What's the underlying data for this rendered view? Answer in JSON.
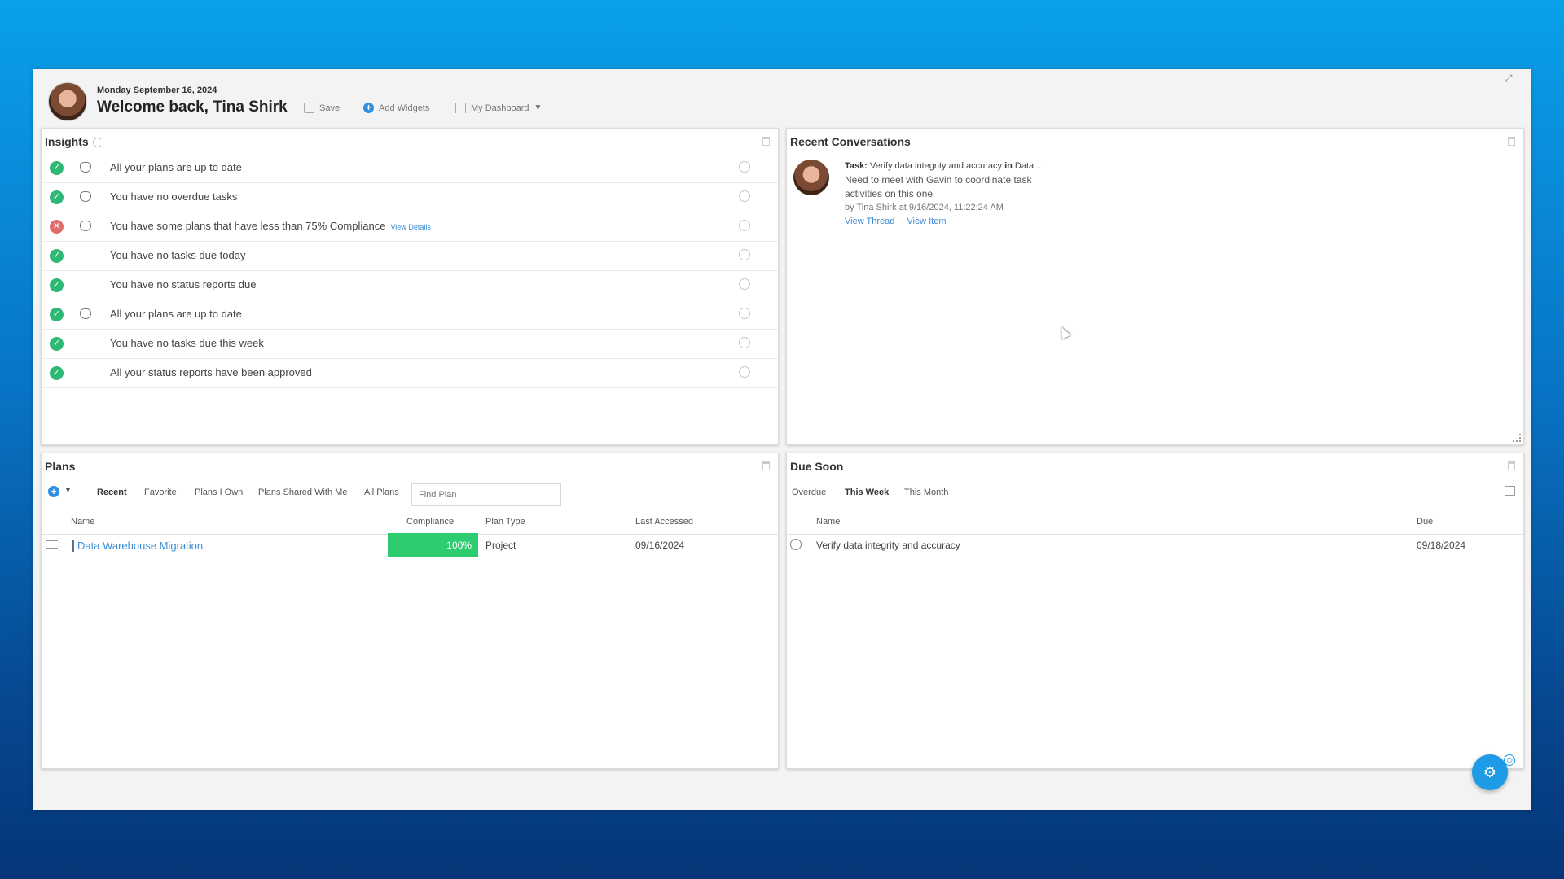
{
  "header": {
    "date": "Monday September 16, 2024",
    "welcome": "Welcome back, Tina Shirk",
    "save_label": "Save",
    "add_widgets_label": "Add Widgets",
    "dashboard_label": "My Dashboard"
  },
  "insights": {
    "title": "Insights",
    "items": [
      {
        "text": "All your plans are up to date",
        "status": "ok"
      },
      {
        "text": "You have no overdue tasks",
        "status": "ok"
      },
      {
        "text": "You have some plans that have less than 75% Compliance",
        "status": "error",
        "link": "View Details"
      },
      {
        "text": "You have no tasks due today",
        "status": "ok"
      },
      {
        "text": "You have no status reports due",
        "status": "ok"
      },
      {
        "text": "All your plans are up to date",
        "status": "ok"
      },
      {
        "text": "You have no tasks due this week",
        "status": "ok"
      },
      {
        "text": "All your status reports have been approved",
        "status": "ok"
      }
    ]
  },
  "conversations": {
    "title": "Recent Conversations",
    "task_prefix": "Task:",
    "task_name": "Verify data integrity and accuracy",
    "in_word": "in",
    "plan_ref": "Data ...",
    "message": "Need to meet with Gavin to coordinate task activities on this one.",
    "byline": "by Tina Shirk at 9/16/2024, 11:22:24 AM",
    "view_thread": "View Thread",
    "view_item": "View Item"
  },
  "plans": {
    "title": "Plans",
    "tabs": [
      "Recent",
      "Favorite",
      "Plans I Own",
      "Plans Shared With Me",
      "All Plans"
    ],
    "active_tab": "Recent",
    "search_placeholder": "Find Plan",
    "columns": [
      "Name",
      "Compliance",
      "Plan Type",
      "Last Accessed"
    ],
    "rows": [
      {
        "name": "Data Warehouse Migration",
        "compliance": "100%",
        "compliance_value": 1.0,
        "plan_type": "Project",
        "last_accessed": "09/16/2024"
      }
    ]
  },
  "due_soon": {
    "title": "Due Soon",
    "tabs": [
      "Overdue",
      "This Week",
      "This Month"
    ],
    "active_tab": "This Week",
    "columns": [
      "Name",
      "Due"
    ],
    "rows": [
      {
        "name": "Verify data integrity and accuracy",
        "due": "09/18/2024"
      }
    ]
  },
  "colors": {
    "accent": "#2f8ee0",
    "success": "#2eb876",
    "error": "#e06c6c",
    "compliance_fill": "#2ecc71",
    "link": "#3c8dd6"
  }
}
